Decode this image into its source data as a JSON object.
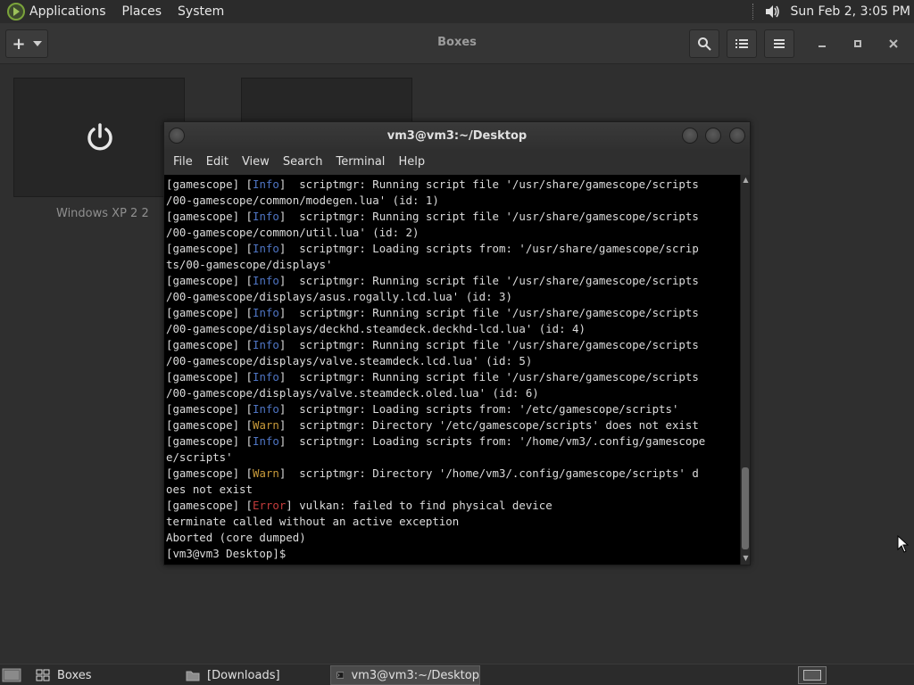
{
  "top_panel": {
    "menu": [
      "Applications",
      "Places",
      "System"
    ],
    "clock": "Sun Feb  2,  3:05 PM"
  },
  "boxes": {
    "title": "Boxes",
    "add_label": "+",
    "vm_label": "Windows XP 2 2"
  },
  "terminal": {
    "title": "vm3@vm3:~/Desktop",
    "menu": [
      "File",
      "Edit",
      "View",
      "Search",
      "Terminal",
      "Help"
    ],
    "lines": [
      {
        "pre": "[gamescope] [",
        "tag": "Info",
        "level": "info",
        "post": "]  scriptmgr: Running script file '/usr/share/gamescope/scripts"
      },
      {
        "text": "/00-gamescope/common/modegen.lua' (id: 1)"
      },
      {
        "pre": "[gamescope] [",
        "tag": "Info",
        "level": "info",
        "post": "]  scriptmgr: Running script file '/usr/share/gamescope/scripts"
      },
      {
        "text": "/00-gamescope/common/util.lua' (id: 2)"
      },
      {
        "pre": "[gamescope] [",
        "tag": "Info",
        "level": "info",
        "post": "]  scriptmgr: Loading scripts from: '/usr/share/gamescope/scrip"
      },
      {
        "text": "ts/00-gamescope/displays'"
      },
      {
        "pre": "[gamescope] [",
        "tag": "Info",
        "level": "info",
        "post": "]  scriptmgr: Running script file '/usr/share/gamescope/scripts"
      },
      {
        "text": "/00-gamescope/displays/asus.rogally.lcd.lua' (id: 3)"
      },
      {
        "pre": "[gamescope] [",
        "tag": "Info",
        "level": "info",
        "post": "]  scriptmgr: Running script file '/usr/share/gamescope/scripts"
      },
      {
        "text": "/00-gamescope/displays/deckhd.steamdeck.deckhd-lcd.lua' (id: 4)"
      },
      {
        "pre": "[gamescope] [",
        "tag": "Info",
        "level": "info",
        "post": "]  scriptmgr: Running script file '/usr/share/gamescope/scripts"
      },
      {
        "text": "/00-gamescope/displays/valve.steamdeck.lcd.lua' (id: 5)"
      },
      {
        "pre": "[gamescope] [",
        "tag": "Info",
        "level": "info",
        "post": "]  scriptmgr: Running script file '/usr/share/gamescope/scripts"
      },
      {
        "text": "/00-gamescope/displays/valve.steamdeck.oled.lua' (id: 6)"
      },
      {
        "pre": "[gamescope] [",
        "tag": "Info",
        "level": "info",
        "post": "]  scriptmgr: Loading scripts from: '/etc/gamescope/scripts'"
      },
      {
        "pre": "[gamescope] [",
        "tag": "Warn",
        "level": "warn",
        "post": "]  scriptmgr: Directory '/etc/gamescope/scripts' does not exist"
      },
      {
        "pre": "[gamescope] [",
        "tag": "Info",
        "level": "info",
        "post": "]  scriptmgr: Loading scripts from: '/home/vm3/.config/gamescope"
      },
      {
        "text": "e/scripts'"
      },
      {
        "pre": "[gamescope] [",
        "tag": "Warn",
        "level": "warn",
        "post": "]  scriptmgr: Directory '/home/vm3/.config/gamescope/scripts' d"
      },
      {
        "text": "oes not exist"
      },
      {
        "pre": "[gamescope] [",
        "tag": "Error",
        "level": "error",
        "post": "] vulkan: failed to find physical device"
      },
      {
        "text": "terminate called without an active exception"
      },
      {
        "text": "Aborted (core dumped)"
      },
      {
        "text": "[vm3@vm3 Desktop]$ "
      }
    ]
  },
  "taskbar": [
    {
      "label": "Boxes",
      "icon": "boxes-icon",
      "active": false
    },
    {
      "label": "[Downloads]",
      "icon": "folder-icon",
      "active": false
    },
    {
      "label": "vm3@vm3:~/Desktop",
      "icon": "terminal-icon",
      "active": true
    }
  ]
}
